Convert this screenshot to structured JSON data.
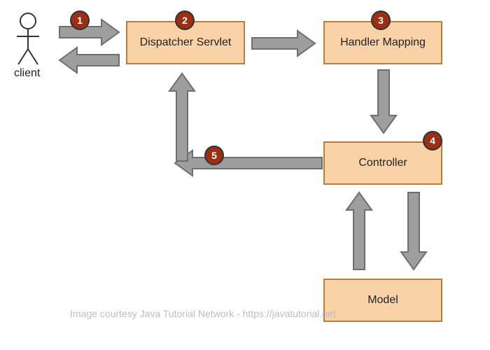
{
  "client_label": "client",
  "boxes": {
    "dispatcher": "Dispatcher Servlet",
    "handler": "Handler Mapping",
    "controller": "Controller",
    "model": "Model"
  },
  "badges": {
    "b1": "1",
    "b2": "2",
    "b3": "3",
    "b4": "4",
    "b5": "5"
  },
  "credit": "Image courtesy Java Tutorial Network - https://javatutorial.net",
  "colors": {
    "arrow_fill": "#9e9e9e",
    "arrow_stroke": "#6f6f6f",
    "stick_stroke": "#333"
  }
}
